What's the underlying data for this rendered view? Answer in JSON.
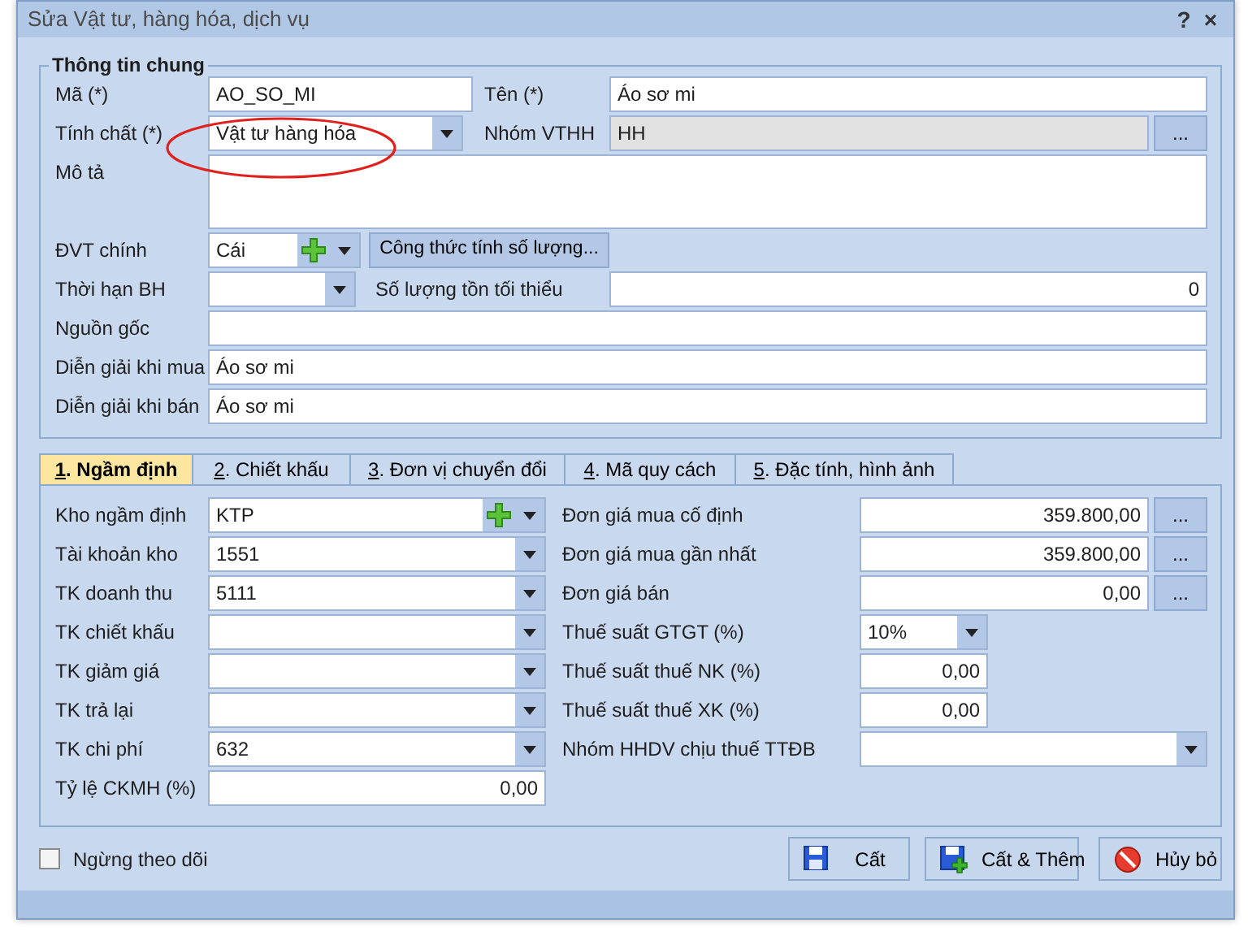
{
  "window": {
    "title": "Sửa Vật tư, hàng hóa, dịch vụ",
    "help": "?",
    "close": "×"
  },
  "general": {
    "legend": "Thông tin chung",
    "rows": [
      [
        {
          "kind": "label",
          "text": "Mã (*)"
        },
        {
          "kind": "input",
          "value": "AO_SO_MI"
        },
        {
          "kind": "label",
          "text": "Tên (*)"
        },
        {
          "kind": "input",
          "value": "Áo sơ mi"
        }
      ],
      [
        {
          "kind": "label",
          "text": "Tính chất (*)"
        },
        {
          "kind": "combo",
          "value": "Vật tư hàng hóa"
        },
        {
          "kind": "label",
          "text": "Nhóm VTHH"
        },
        {
          "kind": "input",
          "value": "HH",
          "disabled": true
        },
        {
          "kind": "ellipsis",
          "text": "..."
        }
      ],
      [
        {
          "kind": "label",
          "text": "Mô tả"
        },
        {
          "kind": "textarea"
        }
      ],
      [
        {
          "kind": "label",
          "text": "ĐVT chính"
        },
        {
          "kind": "combo_add",
          "value": "Cái"
        },
        {
          "kind": "button",
          "text": "Công thức tính số lượng..."
        }
      ],
      [
        {
          "kind": "label",
          "text": "Thời hạn BH"
        },
        {
          "kind": "combo"
        },
        {
          "kind": "label",
          "text": "Số lượng tồn tối thiểu"
        },
        {
          "kind": "number",
          "value": "0"
        }
      ],
      [
        {
          "kind": "label",
          "text": "Nguồn gốc"
        },
        {
          "kind": "input"
        }
      ],
      [
        {
          "kind": "label",
          "text": "Diễn giải khi mua"
        },
        {
          "kind": "input",
          "value": "Áo sơ mi"
        }
      ],
      [
        {
          "kind": "label",
          "text": "Diễn giải khi bán"
        },
        {
          "kind": "input",
          "value": "Áo sơ mi"
        }
      ]
    ]
  },
  "annotation": {
    "kind": "ellipse",
    "color": "#e0201c"
  },
  "tabs": [
    {
      "key": "1",
      "label": ". Ngầm định",
      "selected": true
    },
    {
      "key": "2",
      "label": ". Chiết khấu",
      "selected": false
    },
    {
      "key": "3",
      "label": ". Đơn vị chuyển đổi",
      "selected": false
    },
    {
      "key": "4",
      "label": ". Mã quy cách",
      "selected": false
    },
    {
      "key": "5",
      "label": ". Đặc tính, hình ảnh",
      "selected": false
    }
  ],
  "tab_rows": [
    [
      {
        "kind": "label",
        "text": "Kho ngầm định"
      },
      {
        "kind": "combo_add",
        "value": "KTP"
      },
      {
        "kind": "label",
        "text": "Đơn giá mua cố định"
      },
      {
        "kind": "number",
        "value": "359.800,00"
      },
      {
        "kind": "ellipsis",
        "text": "..."
      }
    ],
    [
      {
        "kind": "label",
        "text": "Tài khoản kho"
      },
      {
        "kind": "combo",
        "value": "1551"
      },
      {
        "kind": "label",
        "text": "Đơn giá mua gần nhất"
      },
      {
        "kind": "number",
        "value": "359.800,00"
      },
      {
        "kind": "ellipsis",
        "text": "..."
      }
    ],
    [
      {
        "kind": "label",
        "text": "TK doanh thu"
      },
      {
        "kind": "combo",
        "value": "5111"
      },
      {
        "kind": "label",
        "text": "Đơn giá bán"
      },
      {
        "kind": "number",
        "value": "0,00"
      },
      {
        "kind": "ellipsis",
        "text": "..."
      }
    ],
    [
      {
        "kind": "label",
        "text": "TK chiết khấu"
      },
      {
        "kind": "combo"
      },
      {
        "kind": "label",
        "text": "Thuế suất GTGT (%)"
      },
      {
        "kind": "combo",
        "value": "10%"
      }
    ],
    [
      {
        "kind": "label",
        "text": "TK giảm giá"
      },
      {
        "kind": "combo"
      },
      {
        "kind": "label",
        "text": "Thuế suất thuế NK (%)"
      },
      {
        "kind": "number",
        "value": "0,00"
      }
    ],
    [
      {
        "kind": "label",
        "text": "TK trả lại"
      },
      {
        "kind": "combo"
      },
      {
        "kind": "label",
        "text": "Thuế suất thuế XK (%)"
      },
      {
        "kind": "number",
        "value": "0,00"
      }
    ],
    [
      {
        "kind": "label",
        "text": "TK chi phí"
      },
      {
        "kind": "combo",
        "value": "632"
      },
      {
        "kind": "label",
        "text": "Nhóm HHDV chịu thuế TTĐB"
      },
      {
        "kind": "combo"
      }
    ],
    [
      {
        "kind": "label",
        "text": "Tỷ lệ CKMH (%)"
      },
      {
        "kind": "number",
        "value": "0,00"
      }
    ]
  ],
  "footer": {
    "checkbox": {
      "label": "Ngừng theo dõi",
      "checked": false
    },
    "buttons": [
      {
        "kind": "save",
        "label": "Cất"
      },
      {
        "kind": "save_add",
        "label": "Cất & Thêm"
      },
      {
        "kind": "cancel",
        "label": "Hủy bỏ"
      }
    ]
  }
}
